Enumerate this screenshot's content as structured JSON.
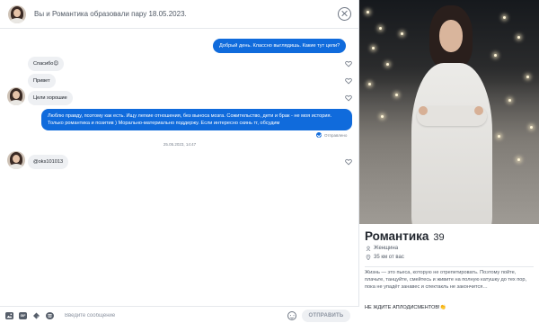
{
  "header": {
    "match_text": "Вы и Романтика образовали пару 18.05.2023."
  },
  "messages": [
    {
      "direction": "out",
      "text": "Добрый день. Классно выглядишь. Какие тут цели?"
    },
    {
      "direction": "in",
      "text": "Спасибо😊"
    },
    {
      "direction": "in",
      "text": "Привет"
    },
    {
      "direction": "in",
      "text": "Цели хорошие"
    },
    {
      "direction": "out",
      "text": "Люблю правду, поэтому как есть. Ищу легкие отношения, без выноса мозга. Сожительство, дети и брак - не моя история. Только романтика и позитив ) Морально-материально поддержу. Если интересно скинь тг, обсудим"
    },
    {
      "direction": "in",
      "text": "@oks101013"
    }
  ],
  "status": {
    "sent": "Отправлено",
    "timestamp": "25.05.2023, 14:47"
  },
  "composer": {
    "placeholder": "Введите сообщение",
    "send_label": "ОТПРАВИТЬ",
    "gif_label": "GIF"
  },
  "profile": {
    "name": "Романтика",
    "age": "39",
    "gender": "Женщина",
    "distance": "35 км от вас",
    "bio": "Жизнь — это пьеса, которую не отрепетировать. Поэтому пойте, плачьте, танцуйте, смейтесь и живите на полную катушку до тех пор, пока не упадёт занавес и спектакль не закончится…",
    "bio_caps": "НЕ ЖДИТЕ АПЛОДИСМЕНТОВ!👏"
  },
  "colors": {
    "accent": "#106bdc",
    "incoming_bubble": "#eef0f3",
    "text": "#21262e"
  },
  "icons": [
    "close-icon",
    "heart-icon",
    "check-icon",
    "gender-icon",
    "location-icon",
    "image-icon",
    "gif-icon",
    "sticker-icon",
    "music-icon",
    "emoji-icon"
  ]
}
